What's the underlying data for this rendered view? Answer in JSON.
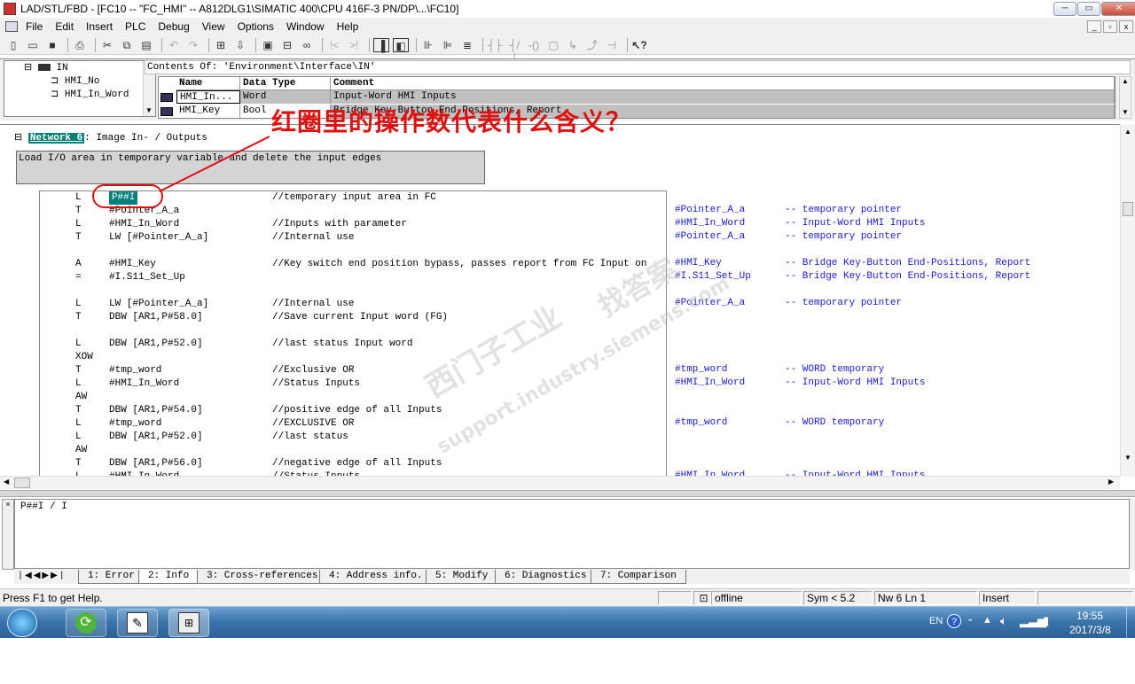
{
  "window": {
    "title": "LAD/STL/FBD  - [FC10 -- \"FC_HMI\" -- A812DLG1\\SIMATIC 400\\CPU 416F-3 PN/DP\\...\\FC10]",
    "controls": {
      "min": "─",
      "max": "▭",
      "close": "✕"
    }
  },
  "menu": {
    "items": [
      "File",
      "Edit",
      "Insert",
      "PLC",
      "Debug",
      "View",
      "Options",
      "Window",
      "Help"
    ],
    "mdi_controls": [
      "_",
      "▫",
      "x"
    ]
  },
  "interface": {
    "contents_of": "Contents Of: 'Environment\\Interface\\IN'",
    "tree": {
      "root": "IN",
      "children": [
        "HMI_No",
        "HMI_In_Word"
      ]
    },
    "columns": [
      "Name",
      "Data Type",
      "Comment"
    ],
    "rows": [
      {
        "name": "HMI_In...",
        "type": "Word",
        "comment": "Input-Word HMI Inputs"
      },
      {
        "name": "HMI_Key",
        "type": "Bool",
        "comment": "Bridge Key-Button End-Positions, Report"
      }
    ]
  },
  "network": {
    "label": "Network 6",
    "title": ": Image In- / Outputs",
    "comment": "Load I/O area in temporary variable and delete the input edges"
  },
  "code": [
    {
      "op": "L",
      "arg": "P##I",
      "cmt": "//temporary input area in FC",
      "sym": "",
      "symcmt": ""
    },
    {
      "op": "T",
      "arg": "#Pointer_A_a",
      "cmt": "",
      "sym": "#Pointer_A_a",
      "symcmt": "-- temporary pointer"
    },
    {
      "op": "L",
      "arg": "#HMI_In_Word",
      "cmt": "//Inputs with parameter",
      "sym": "#HMI_In_Word",
      "symcmt": "-- Input-Word HMI Inputs"
    },
    {
      "op": "T",
      "arg": "LW [#Pointer_A_a]",
      "cmt": "//Internal use",
      "sym": "#Pointer_A_a",
      "symcmt": "-- temporary pointer"
    },
    {
      "op": "",
      "arg": "",
      "cmt": "",
      "sym": "",
      "symcmt": ""
    },
    {
      "op": "A",
      "arg": "#HMI_Key",
      "cmt": "//Key switch end position bypass, passes report from FC Input on",
      "sym": "#HMI_Key",
      "symcmt": "-- Bridge Key-Button End-Positions, Report"
    },
    {
      "op": "=",
      "arg": "#I.S11_Set_Up",
      "cmt": "",
      "sym": "#I.S11_Set_Up",
      "symcmt": "-- Bridge Key-Button End-Positions, Report"
    },
    {
      "op": "",
      "arg": "",
      "cmt": "",
      "sym": "",
      "symcmt": ""
    },
    {
      "op": "L",
      "arg": "LW [#Pointer_A_a]",
      "cmt": "//Internal use",
      "sym": "#Pointer_A_a",
      "symcmt": "-- temporary pointer"
    },
    {
      "op": "T",
      "arg": "DBW [AR1,P#58.0]",
      "cmt": "//Save current Input word (FG)",
      "sym": "",
      "symcmt": ""
    },
    {
      "op": "",
      "arg": "",
      "cmt": "",
      "sym": "",
      "symcmt": ""
    },
    {
      "op": "L",
      "arg": "DBW [AR1,P#52.0]",
      "cmt": "//last status Input word",
      "sym": "",
      "symcmt": ""
    },
    {
      "op": "XOW",
      "arg": "",
      "cmt": "",
      "sym": "",
      "symcmt": ""
    },
    {
      "op": "T",
      "arg": "#tmp_word",
      "cmt": "//Exclusive OR",
      "sym": "#tmp_word",
      "symcmt": "-- WORD temporary"
    },
    {
      "op": "L",
      "arg": "#HMI_In_Word",
      "cmt": "//Status Inputs",
      "sym": "#HMI_In_Word",
      "symcmt": "-- Input-Word HMI Inputs"
    },
    {
      "op": "AW",
      "arg": "",
      "cmt": "",
      "sym": "",
      "symcmt": ""
    },
    {
      "op": "T",
      "arg": "DBW [AR1,P#54.0]",
      "cmt": "//positive edge of all Inputs",
      "sym": "",
      "symcmt": ""
    },
    {
      "op": "L",
      "arg": "#tmp_word",
      "cmt": "//EXCLUSIVE OR",
      "sym": "#tmp_word",
      "symcmt": "-- WORD temporary"
    },
    {
      "op": "L",
      "arg": "DBW [AR1,P#52.0]",
      "cmt": "//last status",
      "sym": "",
      "symcmt": ""
    },
    {
      "op": "AW",
      "arg": "",
      "cmt": "",
      "sym": "",
      "symcmt": ""
    },
    {
      "op": "T",
      "arg": "DBW [AR1,P#56.0]",
      "cmt": "//negative edge of all Inputs",
      "sym": "",
      "symcmt": ""
    },
    {
      "op": "L",
      "arg": "#HMI_In_Word",
      "cmt": "//Status Inputs",
      "sym": "#HMI_In_Word",
      "symcmt": "-- Input-Word HMI Inputs"
    }
  ],
  "annotation": {
    "text": "红圈里的操作数代表什么含义？",
    "color": "#e01010"
  },
  "watermark": {
    "line1": "西门子工业",
    "line2": "support.industry.siemens.com",
    "line3": "找答案"
  },
  "output": {
    "text": "P##I / I",
    "tabs": [
      "1: Error",
      "2: Info",
      "3: Cross-references",
      "4: Address info.",
      "5: Modify",
      "6: Diagnostics",
      "7: Comparison"
    ],
    "active_tab": 1
  },
  "status": {
    "help": "Press F1 to get Help.",
    "mode": "offline",
    "sym": "Sym < 5.2",
    "pos": "Nw 6  Ln 1",
    "ins": "Insert"
  },
  "taskbar": {
    "lang": "EN",
    "time": "19:55",
    "date": "2017/3/8"
  },
  "colors": {
    "network_label_bg": "#00807a",
    "symbol_text": "#1a1acc",
    "selection_bg": "#c0c0c0"
  }
}
